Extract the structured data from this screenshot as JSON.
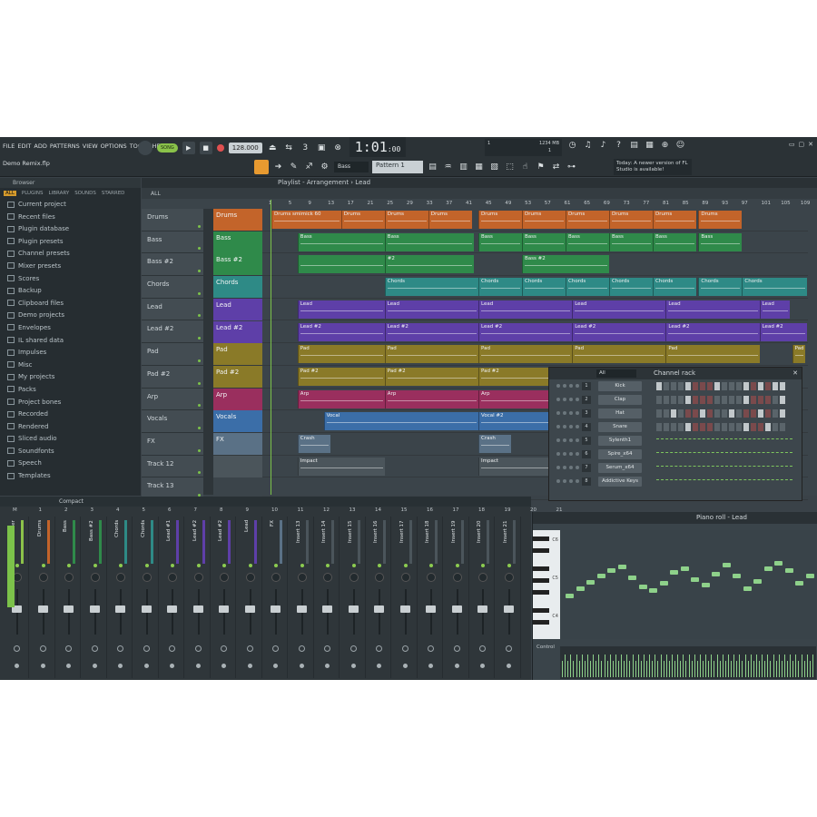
{
  "menu": [
    "FILE",
    "EDIT",
    "ADD",
    "PATTERNS",
    "VIEW",
    "OPTIONS",
    "TOOLS",
    "HELP"
  ],
  "project_name": "Demo Remix.flp",
  "transport": {
    "mode": "SONG",
    "tempo": "128.000",
    "time": "1:01",
    "time_sub": ":00",
    "time_label": "B:S:T"
  },
  "cpu": {
    "value": "1",
    "memory": "1234 MB",
    "polyphony": "1"
  },
  "toolbar": {
    "channel_select": "Bass",
    "pattern": "Pattern 1"
  },
  "hint": "Today: A newer version of FL Studio is available!",
  "browser": {
    "title": "Browser",
    "tabs": [
      "ALL",
      "PLUGINS",
      "LIBRARY",
      "SOUNDS",
      "STARRED"
    ],
    "active_tab": "ALL",
    "items": [
      "Current project",
      "Recent files",
      "Plugin database",
      "Plugin presets",
      "Channel presets",
      "Mixer presets",
      "Scores",
      "Backup",
      "Clipboard files",
      "Demo projects",
      "Envelopes",
      "IL shared data",
      "Impulses",
      "Misc",
      "My projects",
      "Packs",
      "Project bones",
      "Recorded",
      "Rendered",
      "Sliced audio",
      "Soundfonts",
      "Speech",
      "Templates"
    ]
  },
  "playlist": {
    "title": "Playlist - Arrangement › Lead",
    "filter": "ALL",
    "ruler": [
      "1",
      "5",
      "9",
      "13",
      "17",
      "21",
      "25",
      "29",
      "33",
      "37",
      "41",
      "45",
      "49",
      "53",
      "57",
      "61",
      "65",
      "69",
      "73",
      "77",
      "81",
      "85",
      "89",
      "93",
      "97",
      "101",
      "105",
      "109"
    ],
    "track_headers": [
      "Drums",
      "Bass",
      "Bass #2",
      "Chords",
      "Lead",
      "Lead #2",
      "Pad",
      "Pad #2",
      "Arp",
      "Vocals",
      "FX",
      "Track 12",
      "Track 13"
    ],
    "tracks": [
      {
        "name": "Drums",
        "color": "#c3642a",
        "clips": [
          {
            "label": "Drums smimick 60",
            "start": 0,
            "len": 64
          },
          {
            "label": "Drums",
            "start": 64,
            "len": 40
          },
          {
            "label": "Drums",
            "start": 104,
            "len": 40
          },
          {
            "label": "Drums",
            "start": 144,
            "len": 40
          },
          {
            "label": "Drums",
            "start": 190,
            "len": 40
          },
          {
            "label": "Drums",
            "start": 230,
            "len": 40
          },
          {
            "label": "Drums",
            "start": 270,
            "len": 40
          },
          {
            "label": "Drums",
            "start": 310,
            "len": 40
          },
          {
            "label": "Drums",
            "start": 350,
            "len": 40
          },
          {
            "label": "Drums",
            "start": 392,
            "len": 40
          }
        ]
      },
      {
        "name": "Bass",
        "color": "#2f8a4a",
        "clips": [
          {
            "label": "Bass",
            "start": 24,
            "len": 80
          },
          {
            "label": "Bass",
            "start": 104,
            "len": 82
          },
          {
            "label": "Bass",
            "start": 190,
            "len": 40
          },
          {
            "label": "Bass",
            "start": 230,
            "len": 40
          },
          {
            "label": "Bass",
            "start": 270,
            "len": 40
          },
          {
            "label": "Bass",
            "start": 310,
            "len": 40
          },
          {
            "label": "Bass",
            "start": 350,
            "len": 40
          },
          {
            "label": "Bass",
            "start": 392,
            "len": 40
          }
        ]
      },
      {
        "name": "Bass #2",
        "color": "#2f8a4a",
        "clips": [
          {
            "label": "",
            "start": 24,
            "len": 80
          },
          {
            "label": "#2",
            "start": 104,
            "len": 82
          },
          {
            "label": "Bass #2",
            "start": 230,
            "len": 80
          }
        ]
      },
      {
        "name": "Chords",
        "color": "#2e8a86",
        "clips": [
          {
            "label": "Chords",
            "start": 104,
            "len": 86
          },
          {
            "label": "Chords",
            "start": 190,
            "len": 40
          },
          {
            "label": "Chords",
            "start": 230,
            "len": 40
          },
          {
            "label": "Chords",
            "start": 270,
            "len": 40
          },
          {
            "label": "Chords",
            "start": 310,
            "len": 40
          },
          {
            "label": "Chords",
            "start": 350,
            "len": 40
          },
          {
            "label": "Chords",
            "start": 392,
            "len": 40
          },
          {
            "label": "Chords",
            "start": 432,
            "len": 60
          }
        ]
      },
      {
        "name": "Lead",
        "color": "#5e3fa8",
        "clips": [
          {
            "label": "Lead",
            "start": 24,
            "len": 80
          },
          {
            "label": "Lead",
            "start": 104,
            "len": 86
          },
          {
            "label": "Lead",
            "start": 190,
            "len": 86
          },
          {
            "label": "Lead",
            "start": 276,
            "len": 86
          },
          {
            "label": "Lead",
            "start": 362,
            "len": 86
          },
          {
            "label": "Lead",
            "start": 448,
            "len": 28
          }
        ]
      },
      {
        "name": "Lead #2",
        "color": "#5e3fa8",
        "clips": [
          {
            "label": "Lead #2",
            "start": 24,
            "len": 80
          },
          {
            "label": "Lead #2",
            "start": 104,
            "len": 86
          },
          {
            "label": "Lead #2",
            "start": 190,
            "len": 86
          },
          {
            "label": "Lead #2",
            "start": 276,
            "len": 86
          },
          {
            "label": "Lead #2",
            "start": 362,
            "len": 86
          },
          {
            "label": "Lead #2",
            "start": 448,
            "len": 44
          }
        ]
      },
      {
        "name": "Pad",
        "color": "#8a7a28",
        "clips": [
          {
            "label": "Pad",
            "start": 24,
            "len": 80
          },
          {
            "label": "Pad",
            "start": 104,
            "len": 86
          },
          {
            "label": "Pad",
            "start": 190,
            "len": 86
          },
          {
            "label": "Pad",
            "start": 276,
            "len": 86
          },
          {
            "label": "Pad",
            "start": 362,
            "len": 86
          },
          {
            "label": "Pad",
            "start": 478,
            "len": 12
          }
        ]
      },
      {
        "name": "Pad #2",
        "color": "#8a7a28",
        "clips": [
          {
            "label": "Pad #2",
            "start": 24,
            "len": 80
          },
          {
            "label": "Pad #2",
            "start": 104,
            "len": 86
          },
          {
            "label": "Pad #2",
            "start": 190,
            "len": 86
          },
          {
            "label": "Pad #2",
            "start": 276,
            "len": 34
          }
        ]
      },
      {
        "name": "Arp",
        "color": "#9a2f5e",
        "clips": [
          {
            "label": "Arp",
            "start": 24,
            "len": 80
          },
          {
            "label": "Arp",
            "start": 104,
            "len": 86
          },
          {
            "label": "Arp",
            "start": 190,
            "len": 86
          },
          {
            "label": "Arp",
            "start": 276,
            "len": 34
          }
        ]
      },
      {
        "name": "Vocals",
        "color": "#3b6ea8",
        "clips": [
          {
            "label": "Vocal",
            "start": 48,
            "len": 142
          },
          {
            "label": "Vocal #2",
            "start": 190,
            "len": 86
          },
          {
            "label": "Vocal",
            "start": 276,
            "len": 34
          }
        ]
      },
      {
        "name": "FX",
        "color": "#5a7186",
        "clips": [
          {
            "label": "Crash",
            "start": 24,
            "len": 30
          },
          {
            "label": "Crash",
            "start": 190,
            "len": 30
          }
        ]
      },
      {
        "name": "",
        "color": "#4b555b",
        "clips": [
          {
            "label": "Impact",
            "start": 24,
            "len": 80
          },
          {
            "label": "Impact",
            "start": 190,
            "len": 86
          }
        ]
      },
      {
        "name": "",
        "color": "#3b444a",
        "clips": []
      }
    ]
  },
  "channel_rack": {
    "title": "Channel rack",
    "filter": "All",
    "channels": [
      {
        "name": "Kick",
        "num": "1",
        "steps": [
          1,
          0,
          0,
          0,
          1,
          0,
          0,
          0,
          1,
          0,
          0,
          0,
          1,
          0,
          1,
          0,
          1,
          1
        ]
      },
      {
        "name": "Clap",
        "num": "2",
        "steps": [
          0,
          0,
          0,
          0,
          1,
          0,
          0,
          0,
          0,
          0,
          0,
          0,
          1,
          0,
          0,
          0,
          0,
          1
        ]
      },
      {
        "name": "Hat",
        "num": "3",
        "steps": [
          0,
          0,
          1,
          0,
          0,
          0,
          1,
          0,
          0,
          0,
          1,
          0,
          0,
          0,
          1,
          0,
          0,
          1
        ]
      },
      {
        "name": "Snare",
        "num": "4",
        "steps": [
          0,
          0,
          0,
          0,
          1,
          0,
          0,
          0,
          0,
          0,
          0,
          0,
          1,
          0,
          0,
          1,
          0,
          0
        ]
      },
      {
        "name": "Sylenth1",
        "num": "5",
        "steps": null
      },
      {
        "name": "Spire_x64",
        "num": "6",
        "steps": null
      },
      {
        "name": "Serum_x64",
        "num": "7",
        "steps": null
      },
      {
        "name": "Addictive Keys",
        "num": "8",
        "steps": null
      }
    ]
  },
  "mixer": {
    "view": "Compact",
    "numbers": [
      "M",
      "1",
      "2",
      "3",
      "4",
      "5",
      "6",
      "7",
      "8",
      "9",
      "10",
      "11",
      "12",
      "13",
      "14",
      "15",
      "16",
      "17",
      "18",
      "19",
      "20",
      "21"
    ],
    "strips": [
      {
        "label": "Master",
        "color": "#8cc24a"
      },
      {
        "label": "Drums",
        "color": "#c3642a"
      },
      {
        "label": "Bass",
        "color": "#2f8a4a"
      },
      {
        "label": "Bass #2",
        "color": "#2f8a4a"
      },
      {
        "label": "Chords",
        "color": "#2e8a86"
      },
      {
        "label": "Chords",
        "color": "#2e8a86"
      },
      {
        "label": "Lead #1",
        "color": "#5e3fa8"
      },
      {
        "label": "Lead #2",
        "color": "#5e3fa8"
      },
      {
        "label": "Lead #2",
        "color": "#5e3fa8"
      },
      {
        "label": "Lead",
        "color": "#5e3fa8"
      },
      {
        "label": "FX",
        "color": "#5a7186"
      },
      {
        "label": "Insert 13",
        "color": "#4b555b"
      },
      {
        "label": "Insert 14",
        "color": "#4b555b"
      },
      {
        "label": "Insert 15",
        "color": "#4b555b"
      },
      {
        "label": "Insert 16",
        "color": "#4b555b"
      },
      {
        "label": "Insert 17",
        "color": "#4b555b"
      },
      {
        "label": "Insert 18",
        "color": "#4b555b"
      },
      {
        "label": "Insert 19",
        "color": "#4b555b"
      },
      {
        "label": "Insert 20",
        "color": "#4b555b"
      },
      {
        "label": "Insert 21",
        "color": "#4b555b"
      }
    ]
  },
  "piano_roll": {
    "title": "Piano roll - Lead",
    "octaves": [
      "C6",
      "C5",
      "C4"
    ],
    "velocity_label": "Control"
  }
}
